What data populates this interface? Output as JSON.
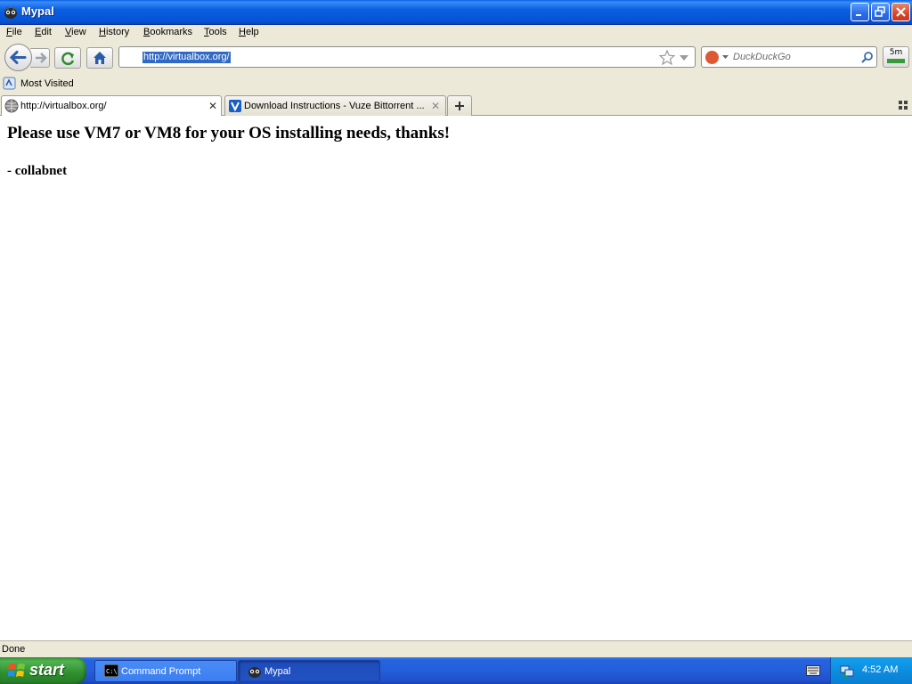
{
  "window": {
    "title": "Mypal"
  },
  "menu": {
    "items": [
      {
        "accel": "F",
        "rest": "ile"
      },
      {
        "accel": "E",
        "rest": "dit"
      },
      {
        "accel": "V",
        "rest": "iew"
      },
      {
        "accel": "H",
        "rest": "istory"
      },
      {
        "accel": "B",
        "rest": "ookmarks"
      },
      {
        "accel": "T",
        "rest": "ools"
      },
      {
        "accel": "H",
        "rest": "elp"
      }
    ]
  },
  "navbar": {
    "url": "http://virtualbox.org/",
    "search_placeholder": "DuckDuckGo",
    "addon_label": "5m"
  },
  "bookmarks": {
    "most_visited": "Most Visited"
  },
  "tabs": [
    {
      "label": "http://virtualbox.org/",
      "active": true
    },
    {
      "label": "Download Instructions - Vuze Bittorrent ...",
      "active": false
    }
  ],
  "page": {
    "heading": "Please use VM7 or VM8 for your OS installing needs, thanks!",
    "signature": "- collabnet"
  },
  "status": {
    "text": "Done"
  },
  "taskbar": {
    "start_label": "start",
    "tasks": [
      {
        "label": "Command Prompt",
        "icon": "cmd-icon"
      },
      {
        "label": "Mypal",
        "icon": "mypal-icon"
      }
    ],
    "clock": "4:52 AM"
  },
  "colors": {
    "titlebar": "#0553d8",
    "selection": "#316ac5",
    "chrome": "#ece9d8",
    "start_green": "#3c9a3c",
    "tray_blue": "#0c8ee0"
  }
}
